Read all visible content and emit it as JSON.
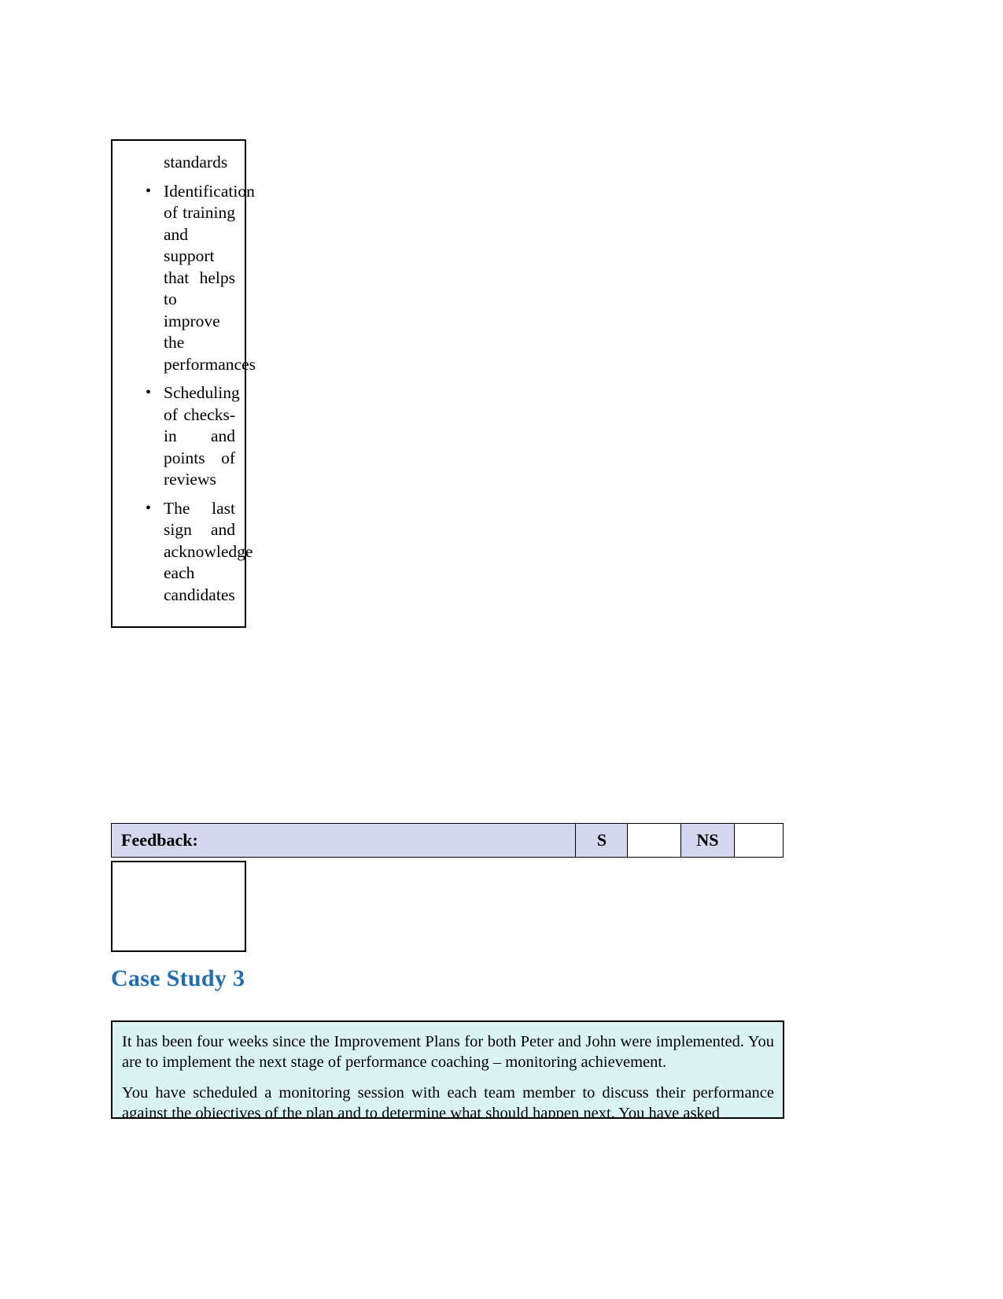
{
  "document": {
    "top_table": {
      "items": [
        {
          "bullet": false,
          "text": "standards"
        },
        {
          "bullet": true,
          "text": "Identification of training and support that helps to improve the performances"
        },
        {
          "bullet": true,
          "text": "Scheduling of checks-in and points of reviews"
        },
        {
          "bullet": true,
          "text": "The last sign and acknowledge each candidates"
        }
      ]
    },
    "feedback_row": {
      "label": "Feedback:",
      "satisfactory_label": "S",
      "satisfactory_value": "",
      "not_satisfactory_label": "NS",
      "not_satisfactory_value": ""
    },
    "bottom_cell": {
      "value": ""
    },
    "case_study": {
      "heading": "Case Study 3",
      "heading_color": "#1f6eb4",
      "box_background": "#d9f4f2",
      "paragraphs": [
        "It has been four weeks since the Improvement Plans for both Peter and John were implemented. You are to implement the next stage of performance coaching – monitoring achievement.",
        "You have scheduled a monitoring session with each team member to discuss their performance against the objectives of the plan and to determine what should happen next. You have asked"
      ]
    }
  }
}
